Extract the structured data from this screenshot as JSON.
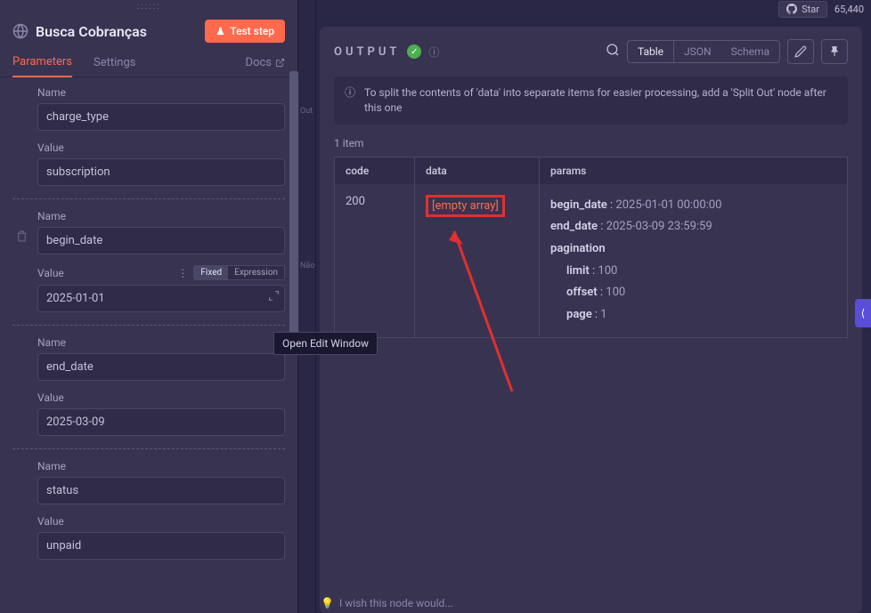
{
  "topbar": {
    "star": "Star",
    "count": "65,440"
  },
  "header": {
    "title": "Busca Cobranças",
    "test_btn": "Test step"
  },
  "tabs": {
    "parameters": "Parameters",
    "settings": "Settings",
    "docs": "Docs"
  },
  "params": [
    {
      "name_label": "Name",
      "name": "charge_type",
      "value_label": "Value",
      "value": "subscription"
    },
    {
      "name_label": "Name",
      "name": "begin_date",
      "value_label": "Value",
      "value": "2025-01-01",
      "has_toggle": true
    },
    {
      "name_label": "Name",
      "name": "end_date",
      "value_label": "Value",
      "value": "2025-03-09"
    },
    {
      "name_label": "Name",
      "name": "status",
      "value_label": "Value",
      "value": "unpaid"
    }
  ],
  "toggle": {
    "fixed": "Fixed",
    "expression": "Expression"
  },
  "tooltip": "Open Edit Window",
  "mid": {
    "out": "Out",
    "nao": "Não"
  },
  "output": {
    "title": "OUTPUT",
    "hint": "To split the contents of 'data' into separate items for easier processing, add a 'Split Out' node after this one",
    "views": {
      "table": "Table",
      "json": "JSON",
      "schema": "Schema"
    },
    "item_count": "1 item",
    "columns": {
      "code": "code",
      "data": "data",
      "params": "params"
    },
    "row": {
      "code": "200",
      "data": "[empty array]",
      "params": {
        "begin_date": {
          "k": "begin_date",
          "v": "2025-01-01 00:00:00"
        },
        "end_date": {
          "k": "end_date",
          "v": "2025-03-09 23:59:59"
        },
        "pagination": "pagination",
        "limit": {
          "k": "limit",
          "v": "100"
        },
        "offset": {
          "k": "offset",
          "v": "100"
        },
        "page": {
          "k": "page",
          "v": "1"
        }
      }
    }
  },
  "footer": "I wish this node would..."
}
